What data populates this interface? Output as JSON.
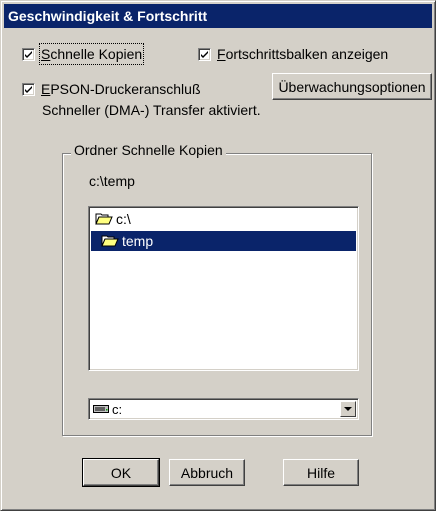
{
  "window": {
    "title": "Geschwindigkeit & Fortschritt"
  },
  "options": {
    "fast_copy": {
      "label_accel": "S",
      "label_rest": "chnelle Kopien",
      "checked": true
    },
    "progress_bar": {
      "label_accel": "F",
      "label_rest": "ortschrittsbalken anzeigen",
      "checked": true
    },
    "epson_port": {
      "label_accel": "E",
      "label_rest": "PSON-Druckeranschluß",
      "checked": true
    },
    "monitoring_button": "Überwachungsoptionen",
    "dma_status": "Schneller (DMA-) Transfer aktiviert."
  },
  "folder_group": {
    "title": "Ordner Schnelle Kopien",
    "current_path": "c:\\temp",
    "folders": [
      {
        "label": "c:\\",
        "icon": "open-folder-icon",
        "selected": false
      },
      {
        "label": "temp",
        "icon": "open-folder-icon",
        "selected": true
      }
    ],
    "drive_select": {
      "value": "c:",
      "icon": "drive-icon"
    }
  },
  "buttons": {
    "ok": "OK",
    "cancel": "Abbruch",
    "help": "Hilfe"
  },
  "colors": {
    "face": "#d4d0c8",
    "title_bar": "#0a246a",
    "selection": "#0a246a"
  }
}
